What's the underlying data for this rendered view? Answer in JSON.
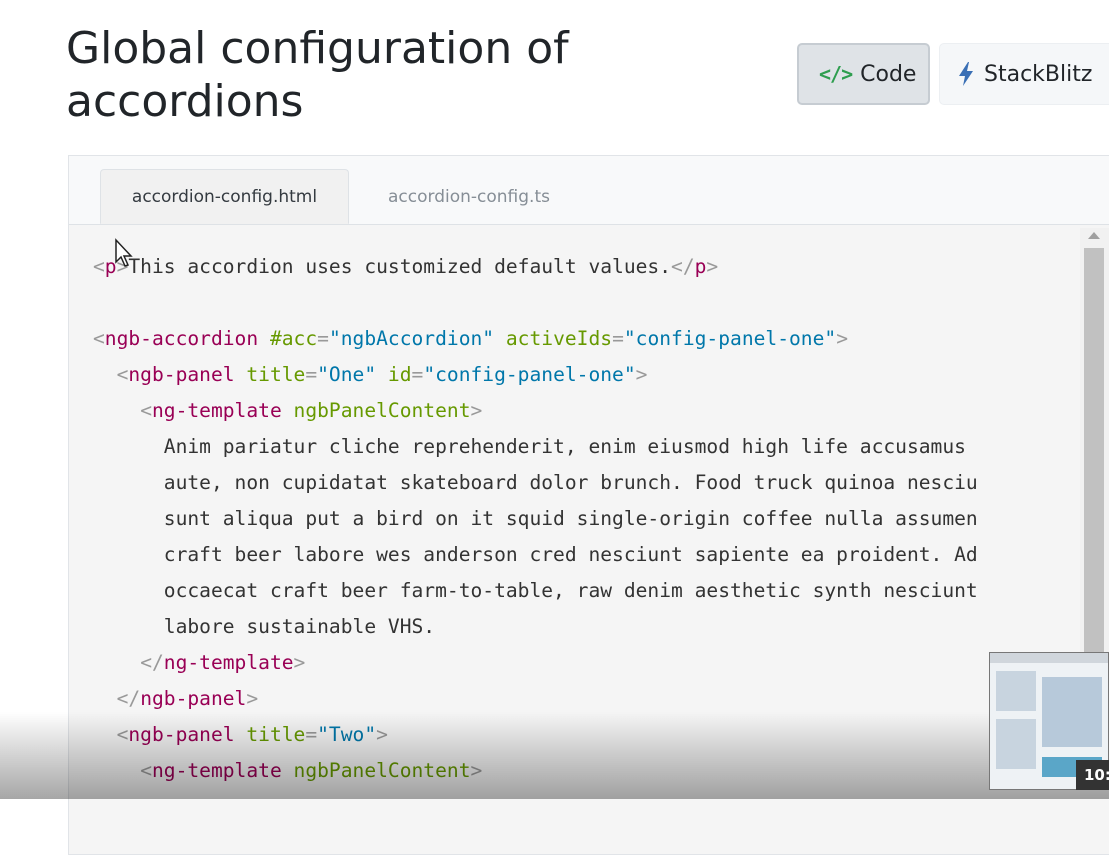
{
  "page": {
    "title": "Global configuration of accordions"
  },
  "toolbar": {
    "code_label": "Code",
    "code_icon": "</>",
    "stackblitz_label": "StackBlitz"
  },
  "tabs": [
    {
      "label": "accordion-config.html",
      "active": true
    },
    {
      "label": "accordion-config.ts",
      "active": false
    }
  ],
  "code_lines": [
    [
      [
        "punc",
        "<"
      ],
      [
        "tag",
        "p"
      ],
      [
        "punc",
        ">"
      ],
      [
        "text",
        "This accordion uses customized default values."
      ],
      [
        "punc",
        "</"
      ],
      [
        "tag",
        "p"
      ],
      [
        "punc",
        ">"
      ]
    ],
    [],
    [
      [
        "punc",
        "<"
      ],
      [
        "tag",
        "ngb-accordion"
      ],
      [
        "text",
        " "
      ],
      [
        "attr",
        "#acc"
      ],
      [
        "punc",
        "="
      ],
      [
        "str",
        "\"ngbAccordion\""
      ],
      [
        "text",
        " "
      ],
      [
        "attr",
        "activeIds"
      ],
      [
        "punc",
        "="
      ],
      [
        "str",
        "\"config-panel-one\""
      ],
      [
        "punc",
        ">"
      ]
    ],
    [
      [
        "text",
        "  "
      ],
      [
        "punc",
        "<"
      ],
      [
        "tag",
        "ngb-panel"
      ],
      [
        "text",
        " "
      ],
      [
        "attr",
        "title"
      ],
      [
        "punc",
        "="
      ],
      [
        "str",
        "\"One\""
      ],
      [
        "text",
        " "
      ],
      [
        "attr",
        "id"
      ],
      [
        "punc",
        "="
      ],
      [
        "str",
        "\"config-panel-one\""
      ],
      [
        "punc",
        ">"
      ]
    ],
    [
      [
        "text",
        "    "
      ],
      [
        "punc",
        "<"
      ],
      [
        "tag",
        "ng-template"
      ],
      [
        "text",
        " "
      ],
      [
        "attr",
        "ngbPanelContent"
      ],
      [
        "punc",
        ">"
      ]
    ],
    [
      [
        "text",
        "      Anim pariatur cliche reprehenderit, enim eiusmod high life accusamus"
      ]
    ],
    [
      [
        "text",
        "      aute, non cupidatat skateboard dolor brunch. Food truck quinoa nesciu"
      ]
    ],
    [
      [
        "text",
        "      sunt aliqua put a bird on it squid single-origin coffee nulla assumen"
      ]
    ],
    [
      [
        "text",
        "      craft beer labore wes anderson cred nesciunt sapiente ea proident. Ad"
      ]
    ],
    [
      [
        "text",
        "      occaecat craft beer farm-to-table, raw denim aesthetic synth nesciunt"
      ]
    ],
    [
      [
        "text",
        "      labore sustainable VHS."
      ]
    ],
    [
      [
        "text",
        "    "
      ],
      [
        "punc",
        "</"
      ],
      [
        "tag",
        "ng-template"
      ],
      [
        "punc",
        ">"
      ]
    ],
    [
      [
        "text",
        "  "
      ],
      [
        "punc",
        "</"
      ],
      [
        "tag",
        "ngb-panel"
      ],
      [
        "punc",
        ">"
      ]
    ],
    [
      [
        "text",
        "  "
      ],
      [
        "punc",
        "<"
      ],
      [
        "tag",
        "ngb-panel"
      ],
      [
        "text",
        " "
      ],
      [
        "attr",
        "title"
      ],
      [
        "punc",
        "="
      ],
      [
        "str",
        "\"Two\""
      ],
      [
        "punc",
        ">"
      ]
    ],
    [
      [
        "text",
        "    "
      ],
      [
        "punc",
        "<"
      ],
      [
        "tag",
        "ng-template"
      ],
      [
        "text",
        " "
      ],
      [
        "attr",
        "ngbPanelContent"
      ],
      [
        "punc",
        ">"
      ]
    ]
  ],
  "video_overlay": {
    "timestamp": "10:"
  },
  "colors": {
    "tag": "#990055",
    "attr": "#669900",
    "string": "#0077aa",
    "punctuation": "#999999",
    "code_icon": "#2e9e4f",
    "bolt_icon": "#3a6fb5"
  },
  "icons": [
    "code-icon",
    "bolt-icon",
    "mouse-cursor-icon",
    "scroll-up-arrow-icon"
  ]
}
